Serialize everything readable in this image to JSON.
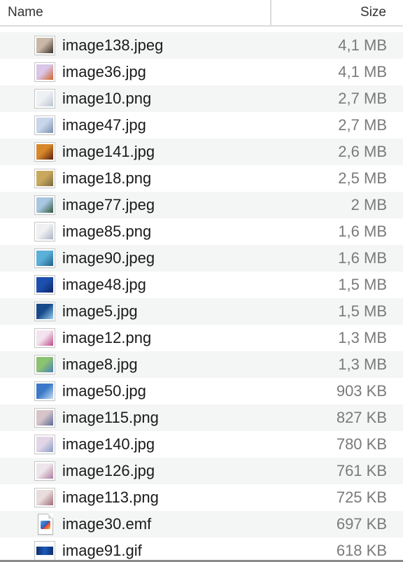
{
  "columns": {
    "name_label": "Name",
    "size_label": "Size"
  },
  "files": [
    {
      "name": "image138.jpeg",
      "size": "4,1 MB",
      "thumb": "#c9b8a6",
      "thumb_accent": "#3a2f28"
    },
    {
      "name": "image36.jpg",
      "size": "4,1 MB",
      "thumb": "#d9c6e8",
      "thumb_accent": "#d4622a"
    },
    {
      "name": "image10.png",
      "size": "2,7 MB",
      "thumb": "#eef1f4",
      "thumb_accent": "#b8c4d2"
    },
    {
      "name": "image47.jpg",
      "size": "2,7 MB",
      "thumb": "#c8d6ea",
      "thumb_accent": "#7b8fb0"
    },
    {
      "name": "image141.jpg",
      "size": "2,6 MB",
      "thumb": "#d8882a",
      "thumb_accent": "#5a1f10"
    },
    {
      "name": "image18.png",
      "size": "2,5 MB",
      "thumb": "#c9a85e",
      "thumb_accent": "#7a6a40"
    },
    {
      "name": "image77.jpeg",
      "size": "2 MB",
      "thumb": "#a8c6e0",
      "thumb_accent": "#2f5a3a"
    },
    {
      "name": "image85.png",
      "size": "1,6 MB",
      "thumb": "#f0f0f2",
      "thumb_accent": "#a9b2c4"
    },
    {
      "name": "image90.jpeg",
      "size": "1,6 MB",
      "thumb": "#5ab0d8",
      "thumb_accent": "#1f5f8a"
    },
    {
      "name": "image48.jpg",
      "size": "1,5 MB",
      "thumb": "#1d4fae",
      "thumb_accent": "#0b2566"
    },
    {
      "name": "image5.jpg",
      "size": "1,5 MB",
      "thumb": "#174a8a",
      "thumb_accent": "#9ad0f0"
    },
    {
      "name": "image12.png",
      "size": "1,3 MB",
      "thumb": "#f2e4ee",
      "thumb_accent": "#c04a8a"
    },
    {
      "name": "image8.jpg",
      "size": "1,3 MB",
      "thumb": "#8cc270",
      "thumb_accent": "#4a80b8"
    },
    {
      "name": "image50.jpg",
      "size": "903 KB",
      "thumb": "#3a78c8",
      "thumb_accent": "#c8dff5"
    },
    {
      "name": "image115.png",
      "size": "827 KB",
      "thumb": "#d6c4c8",
      "thumb_accent": "#5a6a9a"
    },
    {
      "name": "image140.jpg",
      "size": "780 KB",
      "thumb": "#e2d6e6",
      "thumb_accent": "#8a9ac8"
    },
    {
      "name": "image126.jpg",
      "size": "761 KB",
      "thumb": "#ece6ea",
      "thumb_accent": "#b07aa0"
    },
    {
      "name": "image113.png",
      "size": "725 KB",
      "thumb": "#e8dcdc",
      "thumb_accent": "#a06a7a"
    },
    {
      "name": "image30.emf",
      "size": "697 KB",
      "icon": "emf-document-icon"
    },
    {
      "name": "image91.gif",
      "size": "618 KB",
      "icon": "gif-image-icon"
    }
  ]
}
